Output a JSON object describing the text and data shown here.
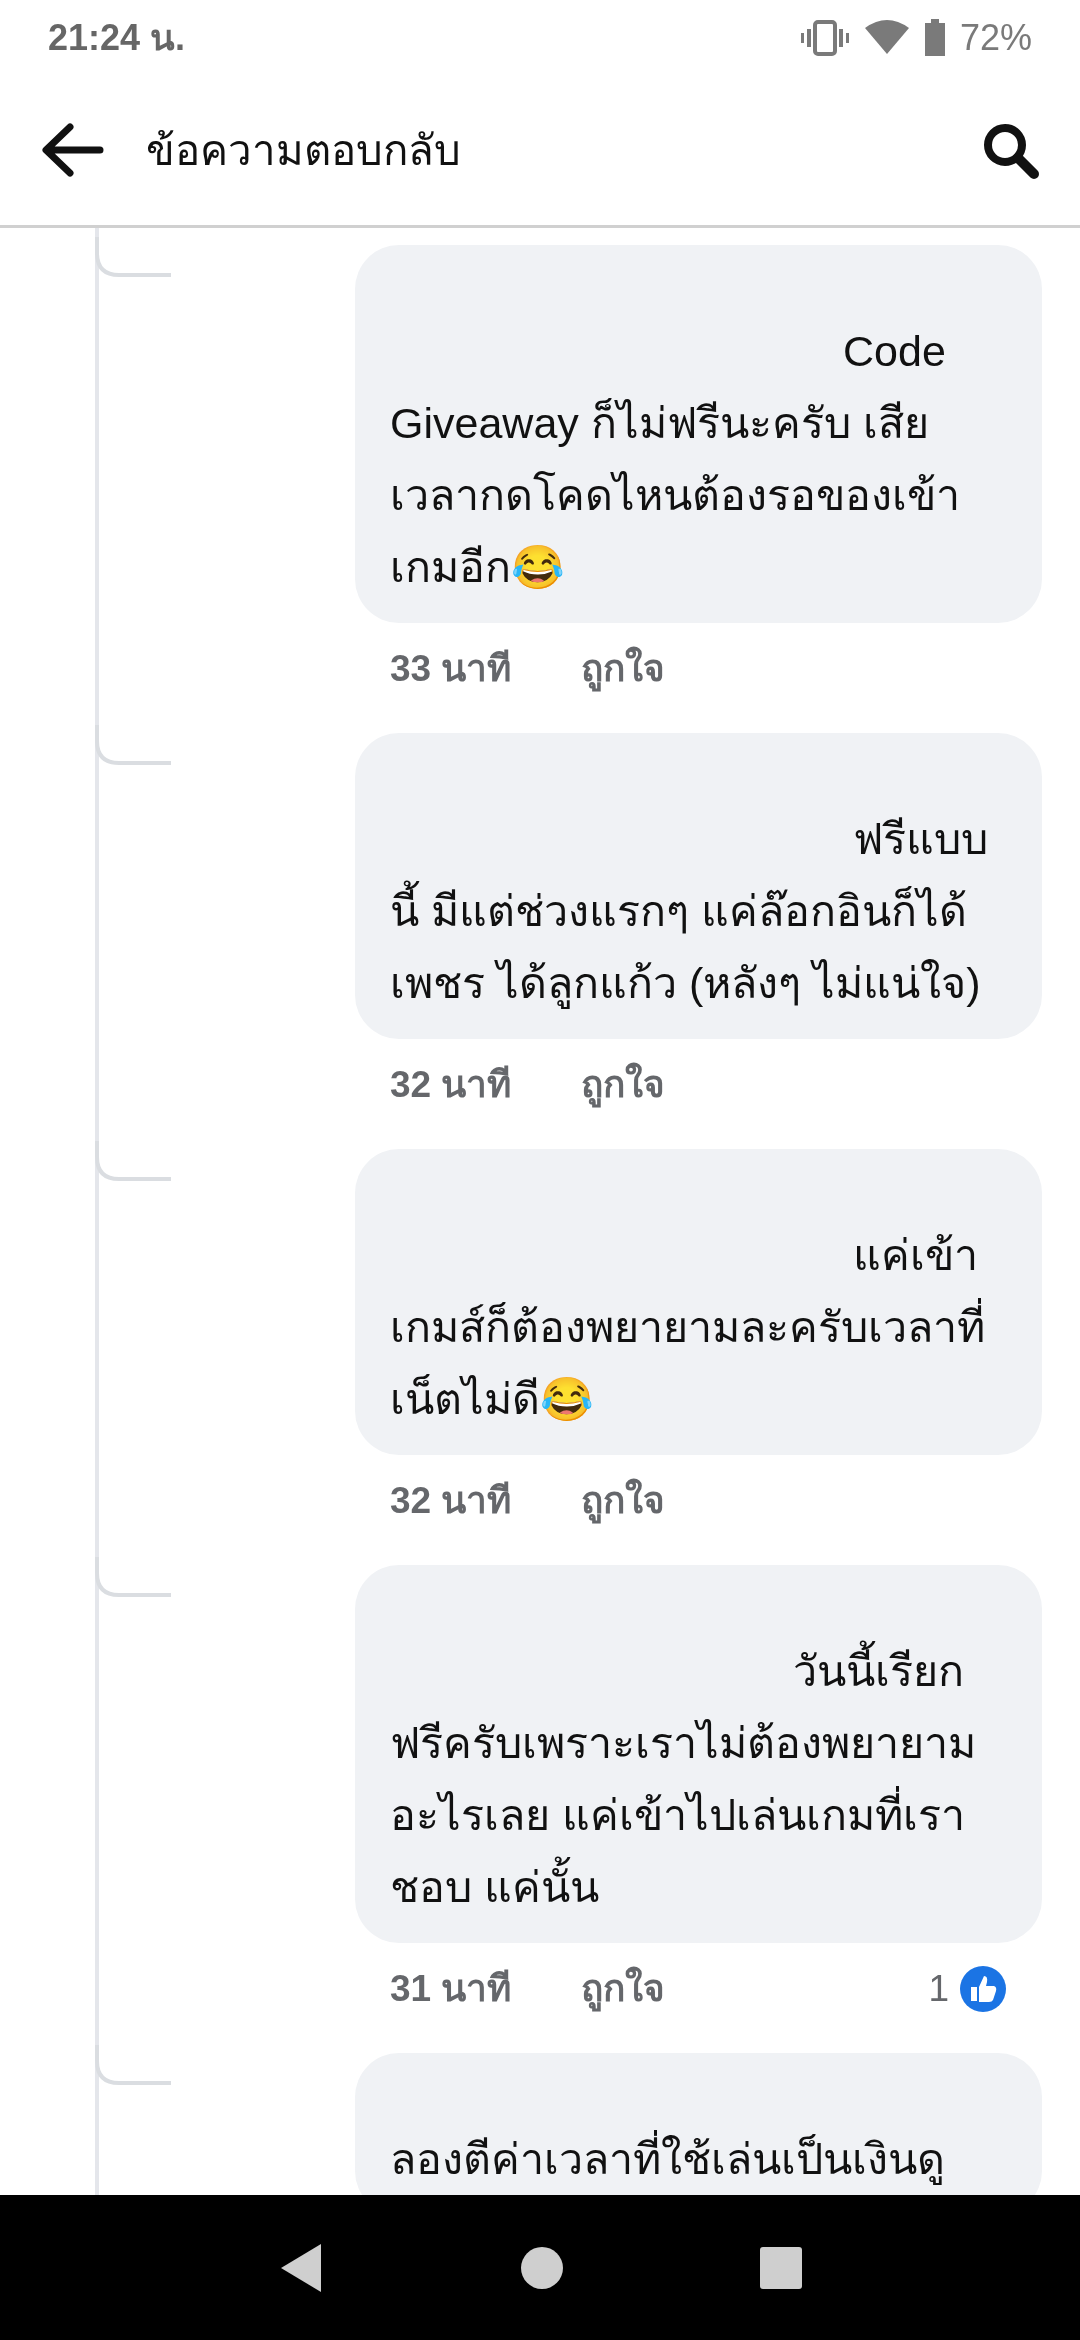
{
  "status_bar": {
    "time": "21:24 น.",
    "battery": "72%"
  },
  "header": {
    "title": "ข้อความตอบกลับ"
  },
  "comments": [
    {
      "text": "Code Giveaway ก็ไม่ฟรีนะครับ เสียเวลากดโคดไหนต้องรอของเข้าเกมอีก😂",
      "time": "33 นาที",
      "like": "ถูกใจ"
    },
    {
      "text": "ฟรีแบบนี้ มีแต่ช่วงแรกๆ แค่ล๊อกอินก็ได้เพชร ได้ลูกแก้ว (หลังๆ ไม่แน่ใจ)",
      "time": "32 นาที",
      "like": "ถูกใจ"
    },
    {
      "text": "แค่เข้าเกมส์ก็ต้องพยายามละครับเวลาที่เน็ตไม่ดี😂",
      "time": "32 นาที",
      "like": "ถูกใจ"
    },
    {
      "text": "วันนี้เรียกฟรีครับเพราะเราไม่ต้องพยายามอะไรเลย แค่เข้าไปเล่นเกมที่เราชอบ แค่นั้น",
      "time": "31 นาที",
      "like": "ถูกใจ",
      "reactions": "1"
    },
    {
      "text": "ลองตีค่าเวลาที่ใช้เล่นเป็นเงินดู"
    }
  ]
}
